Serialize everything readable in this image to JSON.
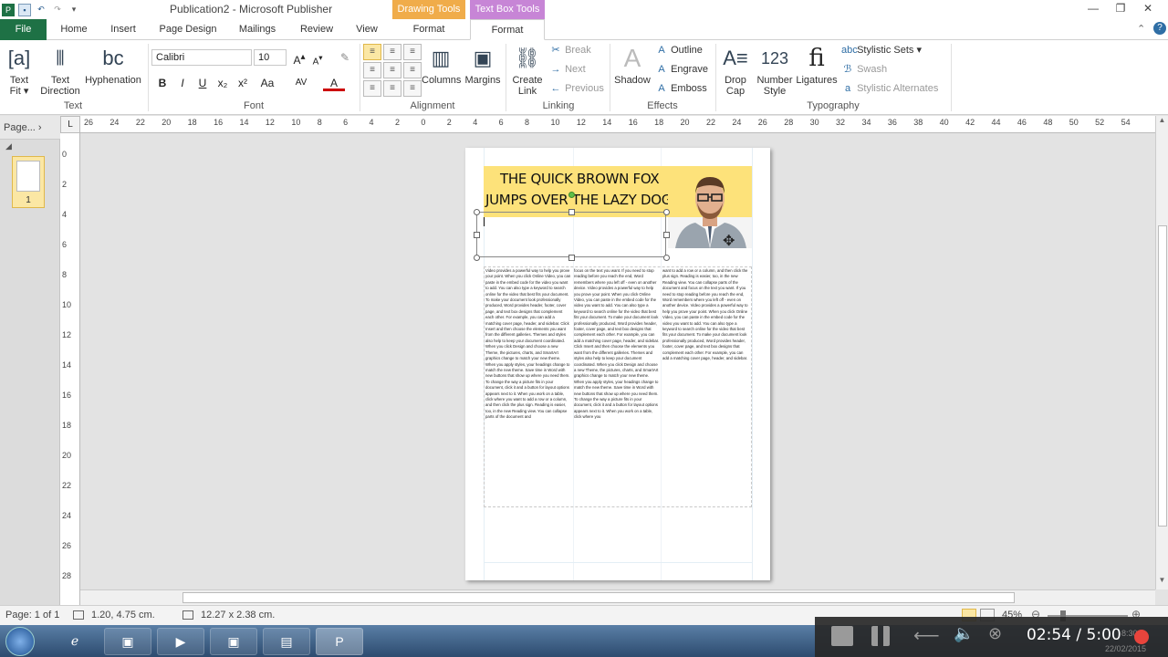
{
  "app": {
    "title": "Publication2 - Microsoft Publisher",
    "context_tabs": [
      "Drawing Tools",
      "Text Box Tools"
    ],
    "window_buttons": [
      "minimize",
      "restore",
      "close"
    ]
  },
  "tabs": [
    "File",
    "Home",
    "Insert",
    "Page Design",
    "Mailings",
    "Review",
    "View",
    "Format",
    "Format"
  ],
  "ribbon": {
    "text_group": {
      "label": "Text",
      "text_fit": "Text Fit",
      "text_direction": "Text Direction",
      "hyphenation": "Hyphenation"
    },
    "font_group": {
      "label": "Font",
      "font_name": "Calibri",
      "font_size": "10",
      "bold": "B",
      "italic": "I",
      "underline": "U",
      "subscript": "x₂",
      "superscript": "x²",
      "change_case": "Aa"
    },
    "alignment_group": {
      "label": "Alignment",
      "columns": "Columns",
      "margins": "Margins"
    },
    "linking_group": {
      "label": "Linking",
      "create_link": "Create Link",
      "break": "Break",
      "next": "Next",
      "previous": "Previous"
    },
    "effects_group": {
      "label": "Effects",
      "shadow": "Shadow",
      "outline": "Outline",
      "engrave": "Engrave",
      "emboss": "Emboss"
    },
    "typography_group": {
      "label": "Typography",
      "drop_cap": "Drop Cap",
      "number_style": "Number Style",
      "number_glyph": "123",
      "ligatures": "Ligatures",
      "ligature_glyph": "fi",
      "stylistic_sets": "Stylistic Sets",
      "swash": "Swash",
      "stylistic_alternates": "Stylistic Alternates"
    }
  },
  "left_pane": {
    "header": "Page...",
    "thumb_number": "1"
  },
  "rulers": {
    "horizontal_ticks": [
      "26",
      "24",
      "22",
      "20",
      "18",
      "16",
      "14",
      "12",
      "10",
      "8",
      "6",
      "4",
      "2",
      "0",
      "2",
      "4",
      "6",
      "8",
      "10",
      "12",
      "14",
      "16",
      "18",
      "20",
      "22",
      "24",
      "26",
      "28",
      "30",
      "32",
      "34",
      "36",
      "38",
      "40",
      "42",
      "44",
      "46",
      "48",
      "50",
      "52",
      "54"
    ],
    "vertical_ticks": [
      "0",
      "2",
      "4",
      "6",
      "8",
      "10",
      "12",
      "14",
      "16",
      "18",
      "20",
      "22",
      "24",
      "26",
      "28"
    ]
  },
  "document": {
    "headline_line1": "THE QUICK BROWN FOX",
    "headline_line2": "JUMPS OVER THE LAZY DOG",
    "col1": "Video provides a powerful way to help you prove your point. When you click Online Video, you can paste in the embed code for the video you want to add. You can also type a keyword to search online for the video that best fits your document. To make your document look professionally produced, Word provides header, footer, cover page, and text box designs that complement each other. For example, you can add a matching cover page, header, and sidebar. Click Insert and then choose the elements you want from the different galleries. Themes and styles also help to keep your document coordinated. When you click Design and choose a new Theme, the pictures, charts, and SmartArt graphics change to match your new theme. When you apply styles, your headings change to match the new theme. Save time in Word with new buttons that show up where you need them. To change the way a picture fits in your document, click it and a button for layout options appears next to it. When you work on a table, click where you want to add a row or a column, and then click the plus sign. Reading is easier, too, in the new Reading view. You can collapse parts of the document and",
    "col2": "focus on the text you want. If you need to stop reading before you reach the end, Word remembers where you left off - even on another device. Video provides a powerful way to help you prove your point. When you click Online Video, you can paste in the embed code for the video you want to add. You can also type a keyword to search online for the video that best fits your document. To make your document look professionally produced, Word provides header, footer, cover page, and text box designs that complement each other. For example, you can add a matching cover page, header, and sidebar. Click Insert and then choose the elements you want from the different galleries. Themes and styles also help to keep your document coordinated. When you click Design and choose a new Theme, the pictures, charts, and SmartArt graphics change to match your new theme. When you apply styles, your headings change to match the new theme. Save time in Word with new buttons that show up where you need them. To change the way a picture fits in your document, click it and a button for layout options appears next to it. When you work on a table, click where you",
    "col3": "want to add a row or a column, and then click the plus sign. Reading is easier, too, in the new Reading view. You can collapse parts of the document and focus on the text you want. If you need to stop reading before you reach the end, Word remembers where you left off - even on another device. Video provides a powerful way to help you prove your point. When you click Online Video, you can paste in the embed code for the video you want to add. You can also type a keyword to search online for the video that best fits your document. To make your document look professionally produced, Word provides header, footer, cover page, and text box designs that complement each other. For example, you can add a matching cover page, header, and sidebar."
  },
  "status": {
    "page": "Page: 1 of 1",
    "position": "1.20, 4.75 cm.",
    "size": "12.27 x 2.38 cm.",
    "zoom": "45%"
  },
  "player": {
    "time": "02:54 / 5:00",
    "date": "22/02/2015",
    "clock": "8:30"
  },
  "colors": {
    "file_tab": "#1e7145",
    "drawing_tools": "#f0ac4a",
    "text_box_tools": "#c785d6",
    "banner": "#fde27a",
    "record": "#e8443c"
  }
}
